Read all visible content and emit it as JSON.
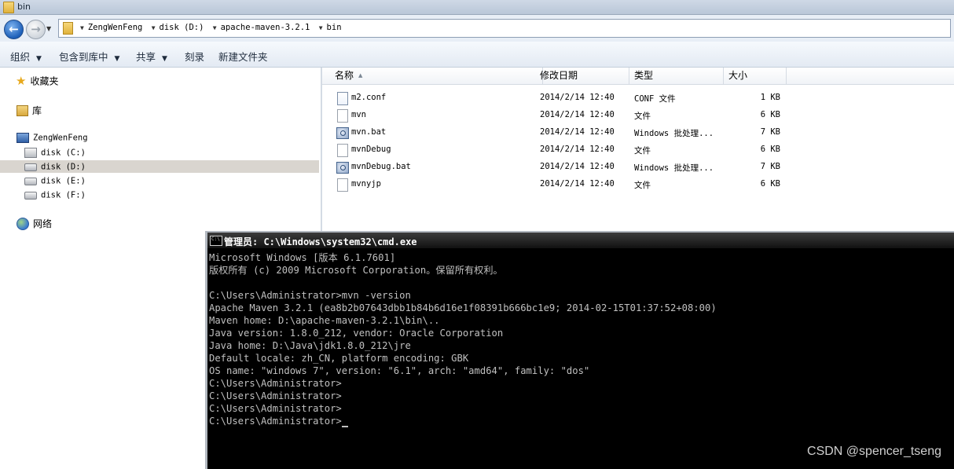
{
  "window": {
    "title": "bin"
  },
  "address": {
    "crumbs": [
      "ZengWenFeng",
      "disk (D:)",
      "apache-maven-3.2.1",
      "bin"
    ]
  },
  "toolbar": {
    "organize": "组织",
    "include_in_library": "包含到库中",
    "share": "共享",
    "burn": "刻录",
    "new_folder": "新建文件夹"
  },
  "nav": {
    "favorites": "收藏夹",
    "libraries": "库",
    "computer": "ZengWenFeng",
    "drives": [
      "disk (C:)",
      "disk (D:)",
      "disk (E:)",
      "disk (F:)"
    ],
    "selected_drive": "disk (D:)",
    "network": "网络"
  },
  "files": {
    "columns": {
      "name": "名称",
      "date": "修改日期",
      "type": "类型",
      "size": "大小"
    },
    "rows": [
      {
        "name": "m2.conf",
        "date": "2014/2/14 12:40",
        "type": "CONF 文件",
        "size": "1 KB",
        "icon": "conf-file-icon"
      },
      {
        "name": "mvn",
        "date": "2014/2/14 12:40",
        "type": "文件",
        "size": "6 KB",
        "icon": "file-icon"
      },
      {
        "name": "mvn.bat",
        "date": "2014/2/14 12:40",
        "type": "Windows 批处理...",
        "size": "7 KB",
        "icon": "batch-file-icon"
      },
      {
        "name": "mvnDebug",
        "date": "2014/2/14 12:40",
        "type": "文件",
        "size": "6 KB",
        "icon": "file-icon"
      },
      {
        "name": "mvnDebug.bat",
        "date": "2014/2/14 12:40",
        "type": "Windows 批处理...",
        "size": "7 KB",
        "icon": "batch-file-icon"
      },
      {
        "name": "mvnyjp",
        "date": "2014/2/14 12:40",
        "type": "文件",
        "size": "6 KB",
        "icon": "file-icon"
      }
    ]
  },
  "cmd": {
    "title": "管理员: C:\\Windows\\system32\\cmd.exe",
    "lines": [
      "Microsoft Windows [版本 6.1.7601]",
      "版权所有 (c) 2009 Microsoft Corporation。保留所有权利。",
      "",
      "C:\\Users\\Administrator>mvn -version",
      "Apache Maven 3.2.1 (ea8b2b07643dbb1b84b6d16e1f08391b666bc1e9; 2014-02-15T01:37:52+08:00)",
      "Maven home: D:\\apache-maven-3.2.1\\bin\\..",
      "Java version: 1.8.0_212, vendor: Oracle Corporation",
      "Java home: D:\\Java\\jdk1.8.0_212\\jre",
      "Default locale: zh_CN, platform encoding: GBK",
      "OS name: \"windows 7\", version: \"6.1\", arch: \"amd64\", family: \"dos\"",
      "C:\\Users\\Administrator>",
      "C:\\Users\\Administrator>",
      "C:\\Users\\Administrator>",
      "C:\\Users\\Administrator>"
    ]
  },
  "watermark": "CSDN @spencer_tseng",
  "colors": {
    "cmd_bg": "#000000",
    "cmd_text": "#c0c0c0",
    "selection": "#d9d5cf"
  }
}
